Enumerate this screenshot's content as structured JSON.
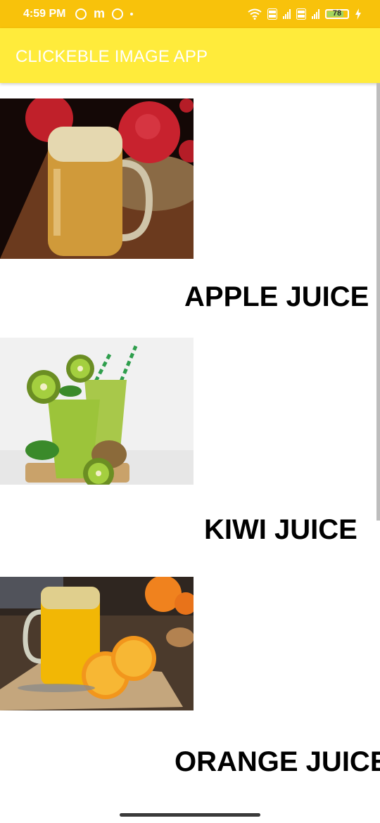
{
  "status_bar": {
    "time": "4:59 PM",
    "battery": "78",
    "icons_left": [
      "circle-icon",
      "m-icon",
      "chrome-icon",
      "dot-icon"
    ],
    "icons_right": [
      "wifi-icon",
      "volte-icon",
      "signal-icon",
      "volte-icon",
      "signal-icon",
      "battery-icon",
      "charging-icon"
    ]
  },
  "app_bar": {
    "title": "CLICKEBLE IMAGE APP"
  },
  "items": [
    {
      "label": "APPLE JUICE",
      "image": "apple-juice-image"
    },
    {
      "label": "KIWI JUICE",
      "image": "kiwi-juice-image"
    },
    {
      "label": "ORANGE JUICE",
      "image": "orange-juice-image"
    }
  ],
  "colors": {
    "status_bar": "#f8c20b",
    "app_bar": "#ffeb3b",
    "app_title": "#ffffff",
    "label": "#000000"
  }
}
